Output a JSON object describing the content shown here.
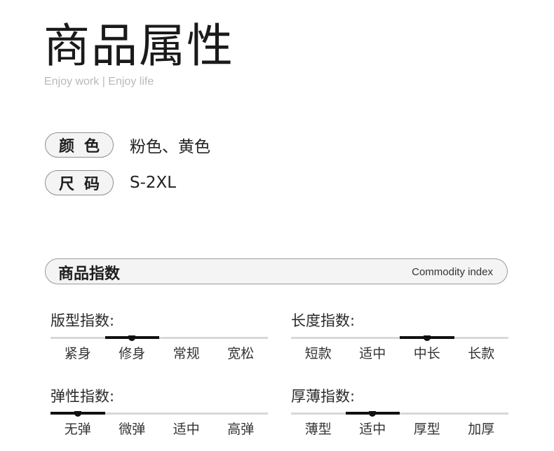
{
  "header": {
    "title": "商品属性",
    "subtitle": "Enjoy work | Enjoy life"
  },
  "attributes": [
    {
      "label": "颜色",
      "value": "粉色、黄色"
    },
    {
      "label": "尺码",
      "value": "S-2XL"
    }
  ],
  "index_section": {
    "title": "商品指数",
    "subtitle": "Commodity index"
  },
  "metrics": [
    {
      "label": "版型指数:",
      "options": [
        "紧身",
        "修身",
        "常规",
        "宽松"
      ],
      "selected": 1
    },
    {
      "label": "长度指数:",
      "options": [
        "短款",
        "适中",
        "中长",
        "长款"
      ],
      "selected": 2
    },
    {
      "label": "弹性指数:",
      "options": [
        "无弹",
        "微弹",
        "适中",
        "高弹"
      ],
      "selected": 0
    },
    {
      "label": "厚薄指数:",
      "options": [
        "薄型",
        "适中",
        "厚型",
        "加厚"
      ],
      "selected": 1
    }
  ]
}
